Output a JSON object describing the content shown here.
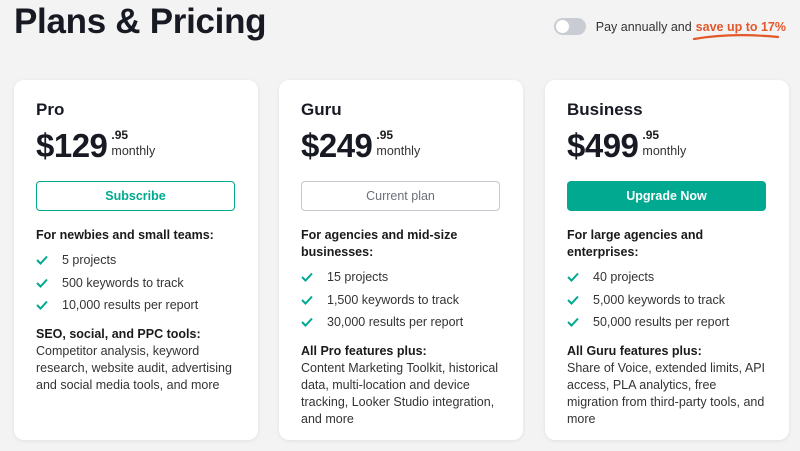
{
  "title": "Plans & Pricing",
  "billing": {
    "label": "Pay annually and",
    "save_text": "save up to 17%",
    "toggle_on": false
  },
  "colors": {
    "accent": "#00a98f",
    "highlight": "#e2582b",
    "background": "#f3f3f3"
  },
  "plans": [
    {
      "name": "Pro",
      "price": "$129",
      "cents": ".95",
      "period": "monthly",
      "button": "Subscribe",
      "audience": "For newbies and small teams:",
      "features": [
        "5 projects",
        "500 keywords to track",
        "10,000 results per report"
      ],
      "tools_heading": "SEO, social, and PPC tools:",
      "tools_text": "Competitor analysis, keyword research, website audit, advertising and social media tools, and more"
    },
    {
      "name": "Guru",
      "price": "$249",
      "cents": ".95",
      "period": "monthly",
      "button": "Current plan",
      "audience": "For agencies and mid-size businesses:",
      "features": [
        "15 projects",
        "1,500 keywords to track",
        "30,000 results per report"
      ],
      "tools_heading": "All Pro features plus:",
      "tools_text": "Content Marketing Toolkit, historical data, multi-location and device tracking, Looker Studio integration, and more"
    },
    {
      "name": "Business",
      "price": "$499",
      "cents": ".95",
      "period": "monthly",
      "button": "Upgrade Now",
      "audience": "For large agencies and enterprises:",
      "features": [
        "40 projects",
        "5,000 keywords to track",
        "50,000 results per report"
      ],
      "tools_heading": "All Guru features plus:",
      "tools_text": "Share of Voice, extended limits, API access, PLA analytics, free migration from third-party tools, and more"
    }
  ]
}
